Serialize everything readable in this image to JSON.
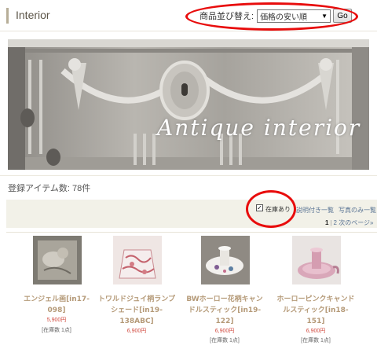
{
  "header": {
    "title": "Interior",
    "sort_label": "商品並び替え:",
    "sort_selected": "価格の安い順",
    "go_label": "Go"
  },
  "banner": {
    "overlay_text": "Antique interior"
  },
  "listing": {
    "item_count": "登録アイテム数: 78件",
    "in_stock_label": "在庫あり",
    "in_stock_checked": true,
    "view_with_desc": "説明付き一覧",
    "view_photos_only": "写真のみ一覧",
    "pager_current": "1",
    "pager_separator": "|",
    "pager_next_page": "2",
    "pager_next": "次のページ»"
  },
  "products": [
    {
      "name": "エンジェル画[in17-098]",
      "price": "5,900円",
      "stock": "[在庫数 1点]"
    },
    {
      "name": "トワルドジュイ柄ランプシェード[in19-138ABC]",
      "price": "6,900円",
      "stock": ""
    },
    {
      "name": "BWホーロー花柄キャンドルスティック[in19-122]",
      "price": "6,900円",
      "stock": "[在庫数 1点]"
    },
    {
      "name": "ホーローピンクキャンドルスティック[in18-151]",
      "price": "6,900円",
      "stock": "[在庫数 1点]"
    }
  ],
  "colors": {
    "annotation_red": "#e80c0c",
    "product_name": "#b59a78",
    "price": "#d14a3f",
    "link": "#5b7595",
    "filter_bar": "#f2f1e8"
  }
}
